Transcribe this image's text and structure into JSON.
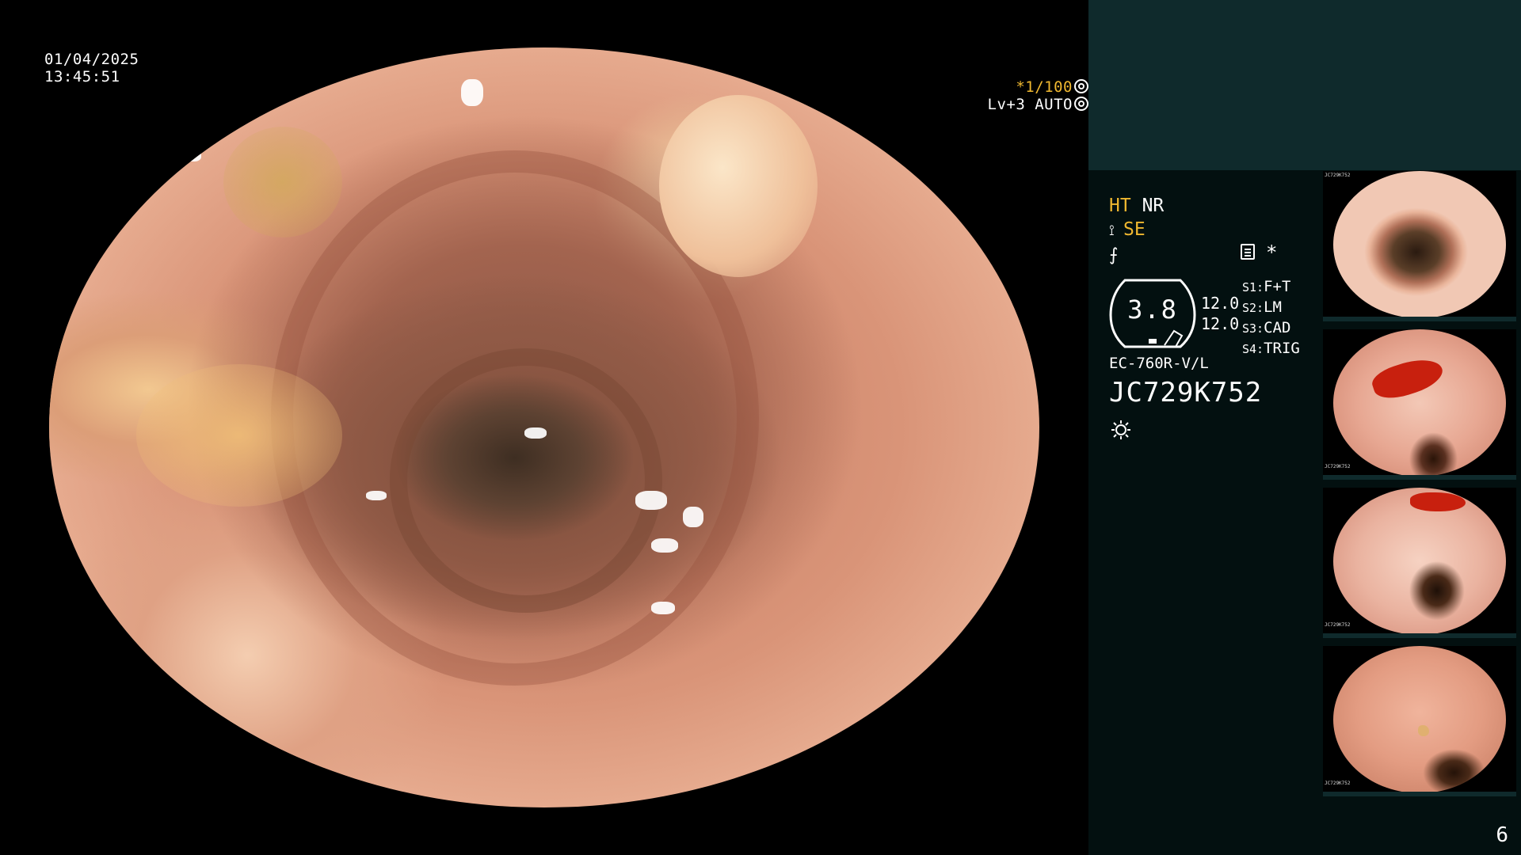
{
  "overlay": {
    "date": "01/04/2025",
    "time": "13:45:51",
    "shutter_value": "*1/100",
    "exposure": "Lv+3 AUTO"
  },
  "settings": {
    "ht_label": "HT",
    "nr_label": "NR",
    "se_label": "SE",
    "gauge_value": "3.8",
    "num_top": "12.0",
    "num_bottom": "12.0",
    "star": "*",
    "modes": [
      {
        "key": "S1:",
        "value": "F+T"
      },
      {
        "key": "S2:",
        "value": "LM"
      },
      {
        "key": "S3:",
        "value": "CAD"
      },
      {
        "key": "S4:",
        "value": "TRIG"
      }
    ]
  },
  "scope": {
    "model": "EC-760R-V/L",
    "serial": "JC729K752"
  },
  "thumbnails": [
    {
      "id": 1,
      "caption": "JC729K752"
    },
    {
      "id": 2,
      "caption": "JC729K752"
    },
    {
      "id": 3,
      "caption": "JC729K752"
    },
    {
      "id": 4,
      "caption": "JC729K752"
    }
  ],
  "page_number": "6",
  "colors": {
    "accent": "#f0b830",
    "panel_bg": "#031010",
    "panel_top": "#0f2a2c"
  }
}
